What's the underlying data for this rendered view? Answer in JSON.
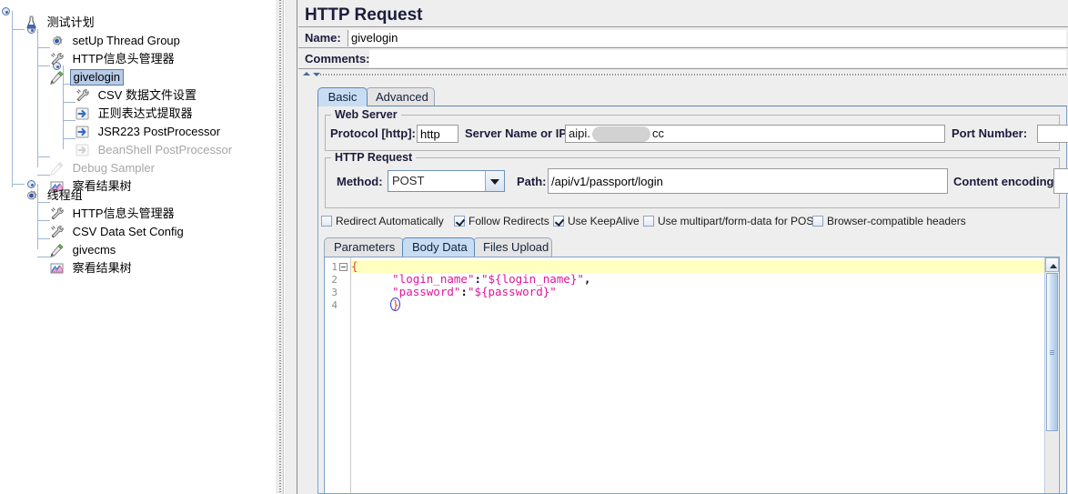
{
  "tree": {
    "items": [
      {
        "label": "测试计划",
        "icon": "test-plan-icon",
        "depth": 0,
        "disabled": false,
        "selected": false,
        "expander": true
      },
      {
        "label": "setUp Thread Group",
        "icon": "thread-group-icon",
        "depth": 1,
        "disabled": false,
        "selected": false,
        "expander": true
      },
      {
        "label": "HTTP信息头管理器",
        "icon": "header-manager-icon",
        "depth": 2,
        "disabled": false,
        "selected": false,
        "expander": false
      },
      {
        "label": "givelogin",
        "icon": "http-sampler-icon",
        "depth": 2,
        "disabled": false,
        "selected": true,
        "expander": true
      },
      {
        "label": "CSV 数据文件设置",
        "icon": "csv-config-icon",
        "depth": 3,
        "disabled": false,
        "selected": false,
        "expander": false
      },
      {
        "label": "正则表达式提取器",
        "icon": "post-processor-icon",
        "depth": 3,
        "disabled": false,
        "selected": false,
        "expander": false
      },
      {
        "label": "JSR223 PostProcessor",
        "icon": "post-processor-icon",
        "depth": 3,
        "disabled": false,
        "selected": false,
        "expander": false
      },
      {
        "label": "BeanShell PostProcessor",
        "icon": "post-processor-icon",
        "depth": 3,
        "disabled": true,
        "selected": false,
        "expander": false
      },
      {
        "label": "Debug Sampler",
        "icon": "http-sampler-icon",
        "depth": 2,
        "disabled": true,
        "selected": false,
        "expander": false
      },
      {
        "label": "察看结果树",
        "icon": "view-results-tree-icon",
        "depth": 2,
        "disabled": false,
        "selected": false,
        "expander": false
      },
      {
        "label": "线程组",
        "icon": "thread-group-icon",
        "depth": 1,
        "disabled": false,
        "selected": false,
        "expander": true
      },
      {
        "label": "HTTP信息头管理器",
        "icon": "header-manager-icon",
        "depth": 2,
        "disabled": false,
        "selected": false,
        "expander": false
      },
      {
        "label": "CSV Data Set Config",
        "icon": "csv-config-icon",
        "depth": 2,
        "disabled": false,
        "selected": false,
        "expander": false
      },
      {
        "label": "givecms",
        "icon": "http-sampler-icon",
        "depth": 2,
        "disabled": false,
        "selected": false,
        "expander": false
      },
      {
        "label": "察看结果树",
        "icon": "view-results-tree-icon",
        "depth": 2,
        "disabled": false,
        "selected": false,
        "expander": false
      }
    ]
  },
  "panel": {
    "title": "HTTP Request",
    "name_label": "Name:",
    "name_value": "givelogin",
    "comments_label": "Comments:",
    "comments_value": ""
  },
  "main_tabs": {
    "items": [
      {
        "label": "Basic",
        "active": true
      },
      {
        "label": "Advanced",
        "active": false
      }
    ]
  },
  "web_server": {
    "title": "Web Server",
    "protocol_label": "Protocol [http]:",
    "protocol_value": "http",
    "server_label": "Server Name or IP:",
    "server_value_prefix": "aipi.",
    "server_value_suffix": "cc",
    "server_redacted": true,
    "port_label": "Port Number:",
    "port_value": ""
  },
  "http_request": {
    "title": "HTTP Request",
    "method_label": "Method:",
    "method_value": "POST",
    "path_label": "Path:",
    "path_value": "/api/v1/passport/login",
    "content_encoding_label": "Content encoding:",
    "content_encoding_value": ""
  },
  "options": [
    {
      "label": "Redirect Automatically",
      "checked": false
    },
    {
      "label": "Follow Redirects",
      "checked": true
    },
    {
      "label": "Use KeepAlive",
      "checked": true
    },
    {
      "label": "Use multipart/form-data for POST",
      "checked": false
    },
    {
      "label": "Browser-compatible headers",
      "checked": false
    }
  ],
  "body_tabs": {
    "items": [
      {
        "label": "Parameters",
        "active": false
      },
      {
        "label": "Body Data",
        "active": true
      },
      {
        "label": "Files Upload",
        "active": false
      }
    ]
  },
  "editor": {
    "line_numbers": [
      "1",
      "2",
      "3",
      "4"
    ],
    "lines": [
      {
        "num": "1",
        "text": "{",
        "highlighted": true,
        "fold": true
      },
      {
        "num": "2",
        "text": "    \"login_name\":\"${login_name}\",",
        "highlighted": false,
        "fold": false
      },
      {
        "num": "3",
        "text": "    \"password\":\"${password}\"",
        "highlighted": false,
        "fold": false
      },
      {
        "num": "4",
        "text": "    }",
        "highlighted": false,
        "fold": false
      }
    ],
    "code_tokens": {
      "l1_brace": "{",
      "l2_str_key": "\"login_name\"",
      "l2_colon": ":",
      "l2_str_val": "\"${login_name}\"",
      "l2_comma": ",",
      "l3_str_key": "\"password\"",
      "l3_colon": ":",
      "l3_str_val": "\"${password}\"",
      "l4_brace": "}"
    }
  },
  "colors": {
    "panel_bg": "#eeeeee",
    "tab_active": "#c9ddf2",
    "selection": "#b8cce8",
    "code_string": "#e0179c",
    "code_brace": "#d94f2b",
    "highlight_line": "#ffffc0"
  }
}
